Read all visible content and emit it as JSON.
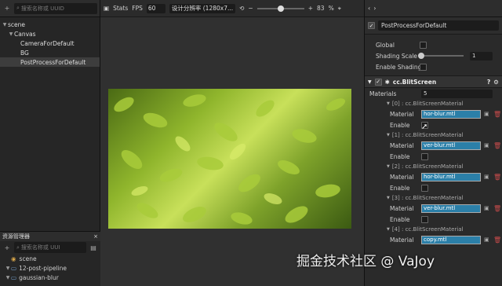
{
  "hierarchy": {
    "search_placeholder": "搜索名称或 UUID",
    "nodes": [
      {
        "label": "scene",
        "depth": 0
      },
      {
        "label": "Canvas",
        "depth": 1
      },
      {
        "label": "CameraForDefault",
        "depth": 2
      },
      {
        "label": "BG",
        "depth": 2
      },
      {
        "label": "PostProcessForDefault",
        "depth": 2
      }
    ]
  },
  "assets": {
    "title": "资源管理器",
    "search_placeholder": "搜索名称或 UUI",
    "items": [
      {
        "label": "scene"
      },
      {
        "label": "12-post-pipeline"
      },
      {
        "label": "gaussian-blur"
      }
    ]
  },
  "scene": {
    "stats_label": "Stats",
    "fps_label": "FPS",
    "fps_value": "60",
    "resolution": "设计分辨率 (1280x7...",
    "zoom_minus": "−",
    "zoom_plus": "+",
    "zoom_value": "83",
    "zoom_unit": "%"
  },
  "inspector": {
    "node_name": "PostProcessForDefault",
    "global_label": "Global",
    "shading_scale_label": "Shading Scale",
    "shading_scale_value": "1",
    "enable_shading_label": "Enable Shading",
    "component_name": "cc.BlitScreen",
    "materials_label": "Materials",
    "materials_count": "5",
    "material_label": "Material",
    "enable_label": "Enable",
    "entries": [
      {
        "header": "[0] : cc.BlitScreenMaterial",
        "material": "hor-blur.mtl"
      },
      {
        "header": "[1] : cc.BlitScreenMaterial",
        "material": "ver-blur.mtl"
      },
      {
        "header": "[2] : cc.BlitScreenMaterial",
        "material": "hor-blur.mtl"
      },
      {
        "header": "[3] : cc.BlitScreenMaterial",
        "material": "ver-blur.mtl"
      },
      {
        "header": "[4] : cc.BlitScreenMaterial",
        "material": "copy.mtl"
      }
    ]
  },
  "watermark": "掘金技术社区 @ VaJoy"
}
